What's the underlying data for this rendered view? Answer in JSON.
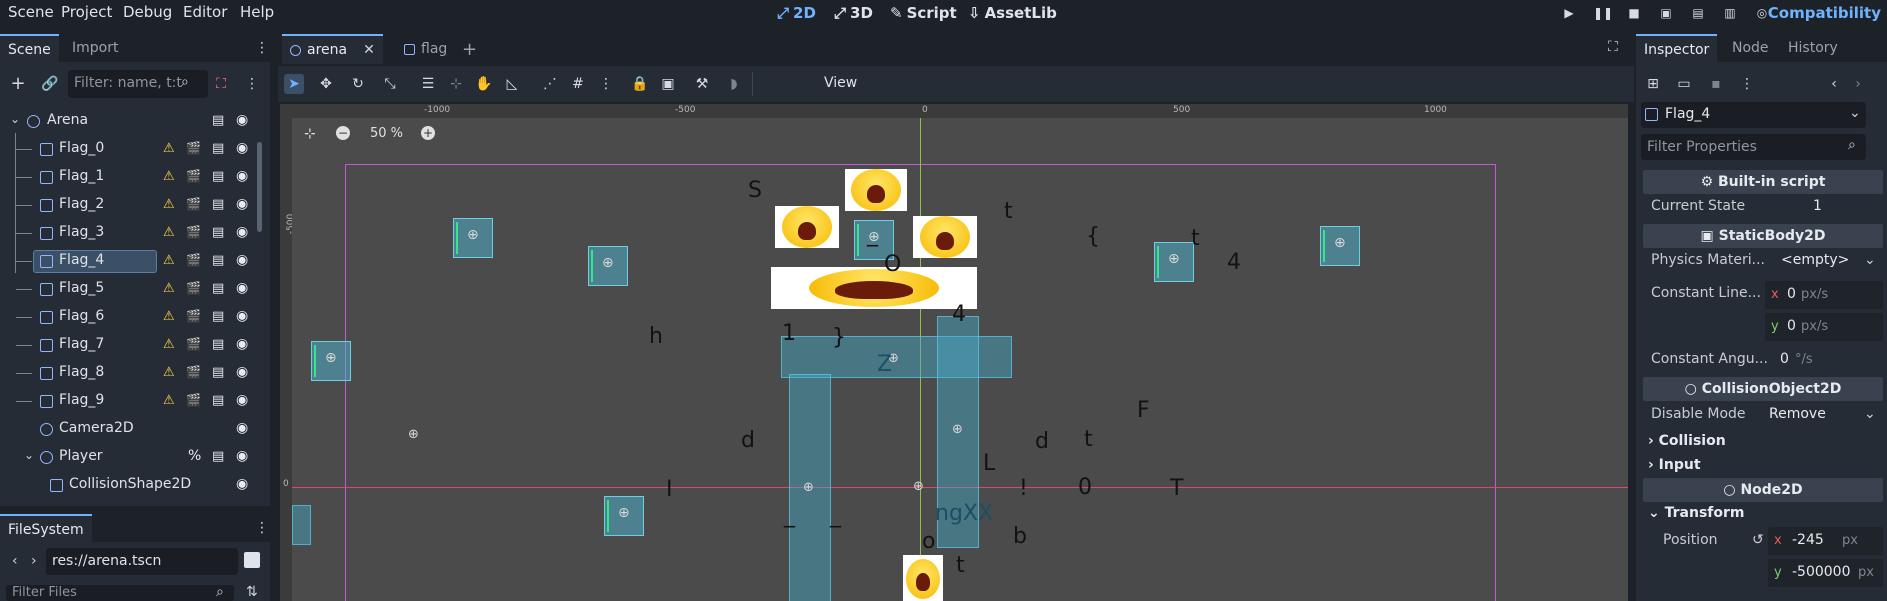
{
  "menu": [
    "Scene",
    "Project",
    "Debug",
    "Editor",
    "Help"
  ],
  "workspaces": [
    {
      "label": "2D",
      "icon": "2d-icon",
      "active": true
    },
    {
      "label": "3D",
      "icon": "3d-icon",
      "active": false
    },
    {
      "label": "Script",
      "icon": "script-icon",
      "active": false
    },
    {
      "label": "AssetLib",
      "icon": "assetlib-icon",
      "active": false
    }
  ],
  "renderer": "Compatibility",
  "scene_dock": {
    "tabs": [
      "Scene",
      "Import"
    ],
    "filter_placeholder": "Filter: name, t:t",
    "root": "Arena",
    "nodes": [
      {
        "label": "Flag_0",
        "warning": true
      },
      {
        "label": "Flag_1",
        "warning": true
      },
      {
        "label": "Flag_2",
        "warning": true
      },
      {
        "label": "Flag_3",
        "warning": true
      },
      {
        "label": "Flag_4",
        "warning": true,
        "selected": true
      },
      {
        "label": "Flag_5",
        "warning": true
      },
      {
        "label": "Flag_6",
        "warning": true
      },
      {
        "label": "Flag_7",
        "warning": true
      },
      {
        "label": "Flag_8",
        "warning": true
      },
      {
        "label": "Flag_9",
        "warning": true
      },
      {
        "label": "Camera2D",
        "warning": false
      },
      {
        "label": "Player",
        "warning": false
      },
      {
        "label": "CollisionShape2D",
        "warning": false
      }
    ],
    "player_badge": "%"
  },
  "filesystem": {
    "tab": "FileSystem",
    "path": "res://arena.tscn",
    "filter_placeholder": "Filter Files"
  },
  "editor_tabs": [
    {
      "label": "arena",
      "active": true
    },
    {
      "label": "flag",
      "active": false
    }
  ],
  "toolbar": {
    "view_label": "View"
  },
  "viewport": {
    "zoom": "50 %",
    "ruler_h": [
      "-1000",
      "-500",
      "0",
      "500",
      "1000"
    ],
    "ruler_v": [
      "-500",
      "0"
    ],
    "scattered_text": [
      "S",
      "t",
      "{",
      "t",
      "4",
      "_",
      "O",
      "4",
      "h",
      "1",
      "}",
      "Z",
      "F",
      "d",
      "d",
      "t",
      "L",
      "I",
      "!",
      "0",
      "T",
      "_",
      "_",
      "ngXX",
      "b",
      "o",
      "t"
    ]
  },
  "inspector": {
    "tabs": [
      "Inspector",
      "Node",
      "History"
    ],
    "object": "Flag_4",
    "filter_placeholder": "Filter Properties",
    "script_section": "Built-in script",
    "current_state_label": "Current State",
    "current_state_value": "1",
    "static_section": "StaticBody2D",
    "physics_material_label": "Physics Materi...",
    "physics_material_value": "<empty>",
    "const_linear_label": "Constant Line...",
    "const_linear_x": "0",
    "const_linear_y": "0",
    "linear_unit": "px/s",
    "const_angular_label": "Constant Angu...",
    "const_angular_value": "0",
    "angular_unit": "°/s",
    "collision_section": "CollisionObject2D",
    "disable_mode_label": "Disable Mode",
    "disable_mode_value": "Remove",
    "collision_group": "Collision",
    "input_group": "Input",
    "node2d_section": "Node2D",
    "transform_group": "Transform",
    "position_label": "Position",
    "position_x": "-245",
    "position_y": "-500000",
    "position_unit": "px",
    "x_axis": "x",
    "y_axis": "y"
  }
}
